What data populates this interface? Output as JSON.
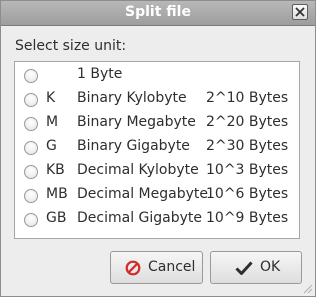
{
  "window": {
    "title": "Split file"
  },
  "prompt_label": "Select size unit:",
  "units": [
    {
      "abbr": "",
      "name": "1 Byte",
      "size": "",
      "selected": false
    },
    {
      "abbr": "K",
      "name": "Binary Kylobyte",
      "size": "2^10 Bytes",
      "selected": false
    },
    {
      "abbr": "M",
      "name": "Binary Megabyte",
      "size": "2^20 Bytes",
      "selected": false
    },
    {
      "abbr": "G",
      "name": "Binary Gigabyte",
      "size": "2^30 Bytes",
      "selected": false
    },
    {
      "abbr": "KB",
      "name": "Decimal Kylobyte",
      "size": "10^3 Bytes",
      "selected": false
    },
    {
      "abbr": "MB",
      "name": "Decimal Megabyte",
      "size": "10^6 Bytes",
      "selected": false
    },
    {
      "abbr": "GB",
      "name": "Decimal Gigabyte",
      "size": "10^9 Bytes",
      "selected": false
    }
  ],
  "buttons": {
    "cancel_label": "Cancel",
    "ok_label": "OK",
    "cancel_icon": "cancel-icon",
    "ok_icon": "checkmark-icon"
  },
  "colors": {
    "titlebar": "#a9a9a9",
    "cancel_icon": "#d22b2b"
  }
}
